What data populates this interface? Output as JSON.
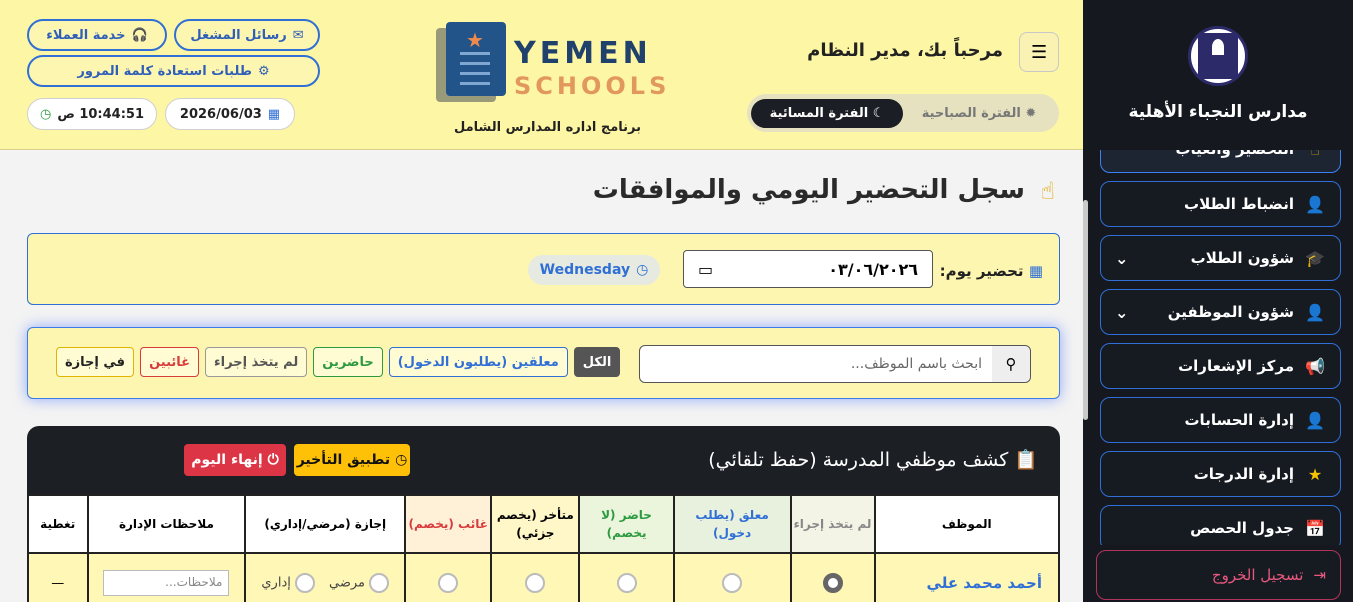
{
  "sidebar": {
    "brand_name": "مدارس النجباء الأهلية",
    "items": [
      {
        "label": "التحضير والغياب",
        "icon": "fingerprint-icon",
        "glyph": "☝"
      },
      {
        "label": "انضباط الطلاب",
        "icon": "user-clock-icon",
        "glyph": "👤"
      },
      {
        "label": "شؤون الطلاب",
        "icon": "graduate-icon",
        "glyph": "🎓"
      },
      {
        "label": "شؤون الموظفين",
        "icon": "user-tie-icon",
        "glyph": "👤"
      },
      {
        "label": "مركز الإشعارات",
        "icon": "megaphone-icon",
        "glyph": "📢"
      },
      {
        "label": "إدارة الحسابات",
        "icon": "user-cog-icon",
        "glyph": "👤"
      },
      {
        "label": "إدارة الدرجات",
        "icon": "star-icon",
        "glyph": "★"
      },
      {
        "label": "جدول الحصص",
        "icon": "calendar-icon",
        "glyph": "📅"
      }
    ],
    "logout_label": "تسجيل الخروج"
  },
  "header": {
    "welcome": "مرحباً بك، مدير النظام",
    "period_morning": "الفترة الصباحية",
    "period_evening": "الفترة المسائية",
    "logo_line1": "YEMEN",
    "logo_line2": "SCHOOLS",
    "subtitle": "برنامج اداره المدارس الشامل",
    "customer_service": "خدمة العملاء",
    "operator_messages": "رسائل المشغل",
    "password_requests": "طلبات استعادة كلمة المرور",
    "date": "2026/06/03",
    "time": "10:44:51 ص"
  },
  "main": {
    "page_title": "سجل التحضير اليومي والموافقات",
    "attendance_day_label": "تحضير يوم:",
    "date_value": "٠٣/٠٦/٢٠٢٦",
    "day_name": "Wednesday",
    "search_placeholder": "ابحث باسم الموظف...",
    "filters": {
      "all": "الكل",
      "pending": "معلقين (يطلبون الدخول)",
      "present": "حاضرين",
      "no_action": "لم يتخذ إجراء",
      "absent": "غائبين",
      "on_leave": "في إجازة"
    },
    "table_title": "كشف موظفي المدرسة (حفظ تلقائي)",
    "apply_delay": "تطبيق التأخير",
    "end_day": "إنهاء اليوم",
    "columns": {
      "employee": "الموظف",
      "no_action": "لم يتخذ إجراء",
      "pending": "معلق (يطلب دخول)",
      "present": "حاضر (لا يخصم)",
      "late": "متأخر (يخصم جزئي)",
      "absent": "غائب (يخصم)",
      "leave": "إجازة (مرضي/إداري)",
      "notes": "ملاحظات الإدارة",
      "coverage": "تغطية"
    },
    "rows": [
      {
        "name": "أحمد محمد علي",
        "leave_sick": "مرضي",
        "leave_admin": "إداري",
        "notes_placeholder": "ملاحظات...",
        "coverage": "—",
        "status": "no_action"
      }
    ]
  },
  "colors": {
    "header_bg": "#fdf6a5",
    "sidebar_bg": "#15191f",
    "accent_blue": "#2f6fd6",
    "warning": "#ffc107",
    "danger": "#dc3545"
  }
}
